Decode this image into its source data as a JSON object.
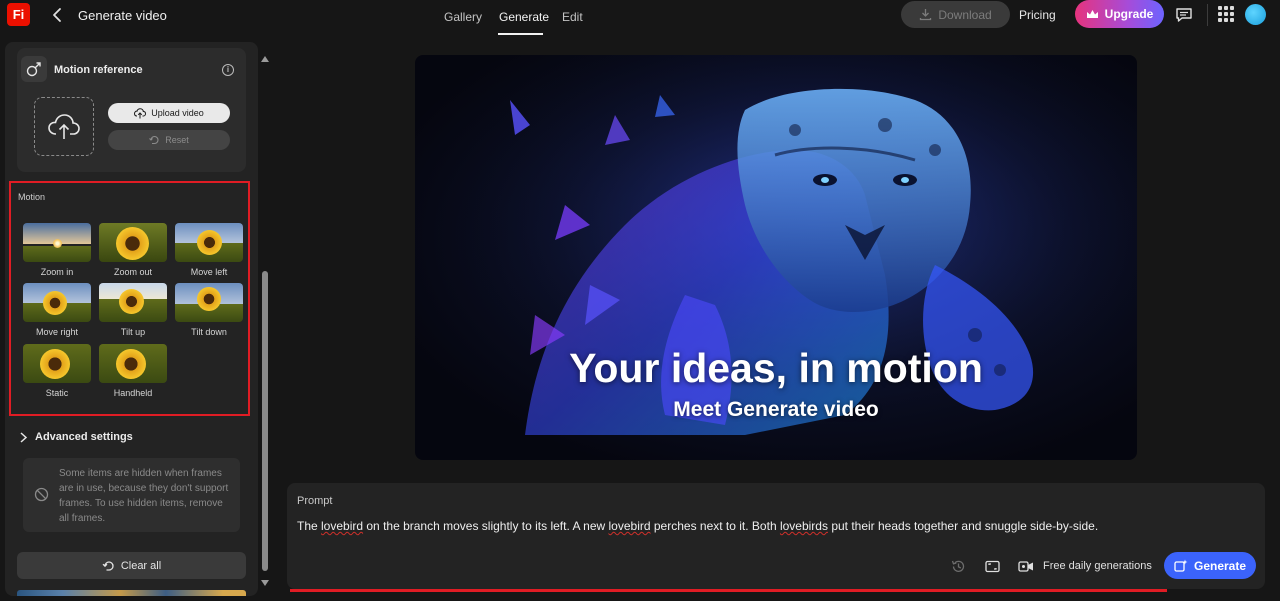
{
  "app": {
    "logo": "Fi",
    "window_title": "Generate video"
  },
  "nav": {
    "tabs": [
      "Gallery",
      "Generate",
      "Edit"
    ],
    "active": "Generate"
  },
  "header": {
    "download_label": "Download",
    "pricing_label": "Pricing",
    "upgrade_label": "Upgrade"
  },
  "motion_reference": {
    "title": "Motion reference",
    "upload_label": "Upload video",
    "reset_label": "Reset"
  },
  "motion": {
    "section_label": "Motion",
    "options": [
      "Zoom in",
      "Zoom out",
      "Move left",
      "Move right",
      "Tilt up",
      "Tilt down",
      "Static",
      "Handheld"
    ]
  },
  "advanced": {
    "label": "Advanced settings",
    "note": "Some items are hidden when frames are in use, because they don't support frames. To use hidden items, remove all frames."
  },
  "clear_all_label": "Clear all",
  "hero": {
    "title": "Your ideas, in motion",
    "subtitle": "Meet Generate video"
  },
  "prompt": {
    "label": "Prompt",
    "text_parts": [
      "The ",
      "lovebird",
      " on the branch moves slightly to its left. A new ",
      "lovebird",
      " perches next to it. Both ",
      "lovebirds",
      " put their heads together and snuggle side-by-side."
    ],
    "free_label": "Free daily generations",
    "generate_label": "Generate"
  },
  "colors": {
    "accent_blue": "#3b63fb",
    "highlight_red": "#e01c24",
    "logo_red": "#eb1000"
  }
}
